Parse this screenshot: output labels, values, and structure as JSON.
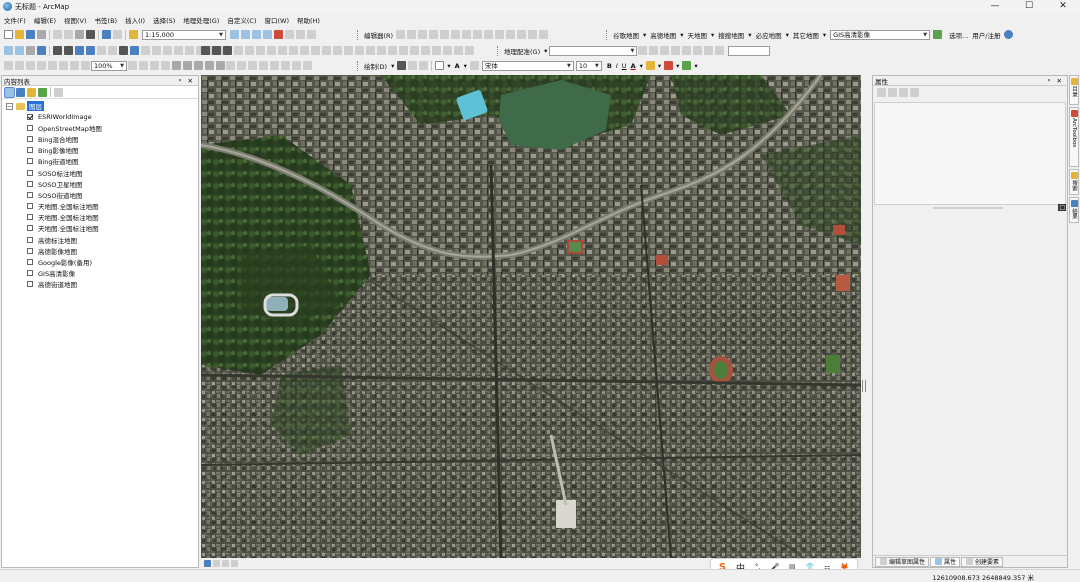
{
  "window": {
    "title": "无标题 - ArcMap",
    "controls": {
      "minimize": "—",
      "maximize": "☐",
      "close": "✕"
    }
  },
  "menu": [
    "文件(F)",
    "编辑(E)",
    "视图(V)",
    "书签(B)",
    "插入(I)",
    "选择(S)",
    "地理处理(G)",
    "自定义(C)",
    "窗口(W)",
    "帮助(H)"
  ],
  "toolbars": {
    "scale": "1:15,000",
    "editor_label": "编辑器(R)",
    "basemap_buttons": [
      "谷歌地图",
      "高德地图",
      "天地图",
      "搜搜地图",
      "必应地图",
      "其它地图"
    ],
    "gis_source": "GIS高清影像",
    "options_label": "选项...",
    "register_label": "用户/注册",
    "georef_label": "地理配准(G)",
    "zoom_percent": "100%",
    "draw_label": "绘制(D)",
    "font_name": "宋体",
    "font_size": "10",
    "bold": "B",
    "italic": "I",
    "underline": "U",
    "font_color_letter": "A",
    "text_tool_letter": "A"
  },
  "toc": {
    "title": "内容列表",
    "title_controls": "ᵖ ✕",
    "group": {
      "label": "图层",
      "expanded_symbol": "−"
    },
    "layers": [
      {
        "label": "ESRIWorldImage",
        "checked": true
      },
      {
        "label": "OpenStreetMap地图",
        "checked": false
      },
      {
        "label": "Bing混合地图",
        "checked": false
      },
      {
        "label": "Bing影像地图",
        "checked": false
      },
      {
        "label": "Bing街道地图",
        "checked": false
      },
      {
        "label": "SOSO标注地图",
        "checked": false
      },
      {
        "label": "SOSO卫星地图",
        "checked": false
      },
      {
        "label": "SOSO街道地图",
        "checked": false
      },
      {
        "label": "天地图.全国标注地图",
        "checked": false
      },
      {
        "label": "天地图.全国标注地图",
        "checked": false
      },
      {
        "label": "天地图.全国标注地图",
        "checked": false
      },
      {
        "label": "高德标注地图",
        "checked": false
      },
      {
        "label": "高德影像地图",
        "checked": false
      },
      {
        "label": "Google影像(备用)",
        "checked": false
      },
      {
        "label": "GIS高清影像",
        "checked": false
      },
      {
        "label": "高德街道地图",
        "checked": false
      }
    ]
  },
  "properties": {
    "title": "属性",
    "title_controls": "ᵖ ✕",
    "corner_badge": "□",
    "tabs": [
      "编辑草图属性",
      "属性",
      "创建要素"
    ]
  },
  "side_tabs": [
    "目录",
    "ArcToolbox",
    "搜索",
    "结果"
  ],
  "ime": {
    "logo": "S",
    "mode": "中",
    "icons": [
      "°,",
      "🎤",
      "▤",
      "👕",
      "⚏",
      "🦊"
    ]
  },
  "status": {
    "coordinates": "12610908.673   2648849.357 米"
  },
  "colors": {
    "selection": "#2a6fd6",
    "folder": "#e8c35a",
    "ime_logo": "#f46b16"
  }
}
